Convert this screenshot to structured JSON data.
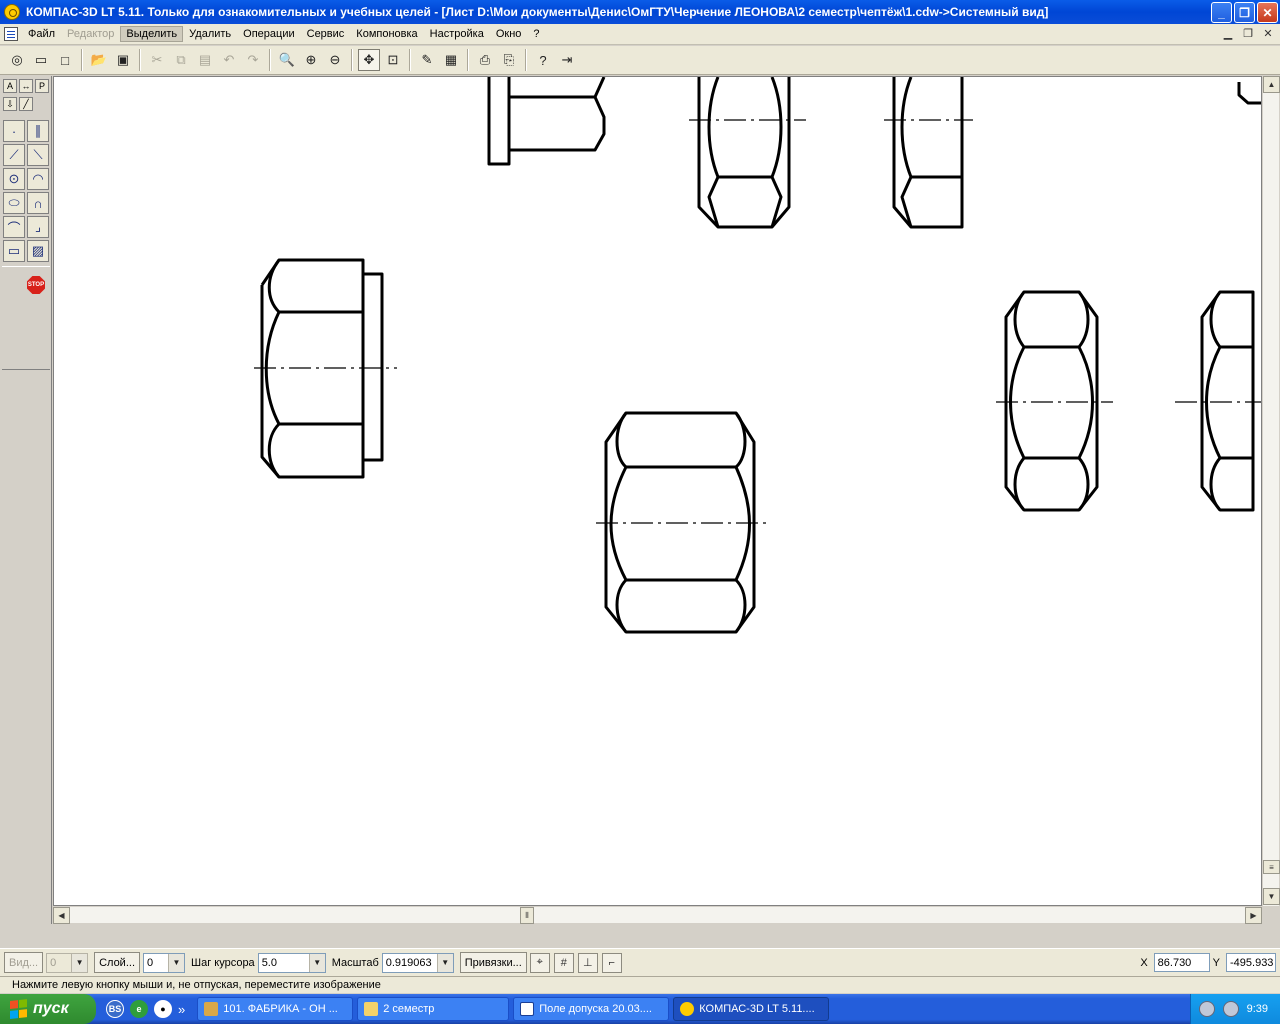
{
  "window": {
    "title": "КОМПАС-3D LT 5.11. Только для ознакомительных и учебных целей - [Лист D:\\Мои документы\\Денис\\ОмГТУ\\Черчение ЛЕОНОВА\\2 семестр\\чептёж\\1.cdw->Системный вид]",
    "minimize": "_",
    "restore": "❐",
    "close": "✕"
  },
  "menu": {
    "items": [
      "Файл",
      "Редактор",
      "Выделить",
      "Удалить",
      "Операции",
      "Сервис",
      "Компоновка",
      "Настройка",
      "Окно",
      "?"
    ]
  },
  "propbar": {
    "view_label": "Вид...",
    "view_value": "0",
    "layer_label": "Слой...",
    "layer_value": "0",
    "step_label": "Шаг курсора",
    "step_value": "5.0",
    "scale_label": "Масштаб",
    "scale_value": "0.919063",
    "snaps_label": "Привязки...",
    "x_label": "X",
    "x_value": "86.730",
    "y_label": "Y",
    "y_value": "-495.933"
  },
  "status": {
    "text": "Нажмите левую кнопку мыши и, не отпуская, переместите изображение"
  },
  "taskbar": {
    "start": "пуск",
    "items": [
      {
        "label": "101. ФАБРИКА - ОН ..."
      },
      {
        "label": "2 семестр"
      },
      {
        "label": "Поле допуска 20.03...."
      },
      {
        "label": "КОМПАС-3D LT 5.11...."
      }
    ],
    "clock": "9:39",
    "quicklaunch_more": "»"
  },
  "colors": {
    "title_blue": "#0a5ce8",
    "taskbar_blue": "#245edb",
    "start_green": "#3fa43f",
    "canvas_bg": "#ffffff"
  }
}
